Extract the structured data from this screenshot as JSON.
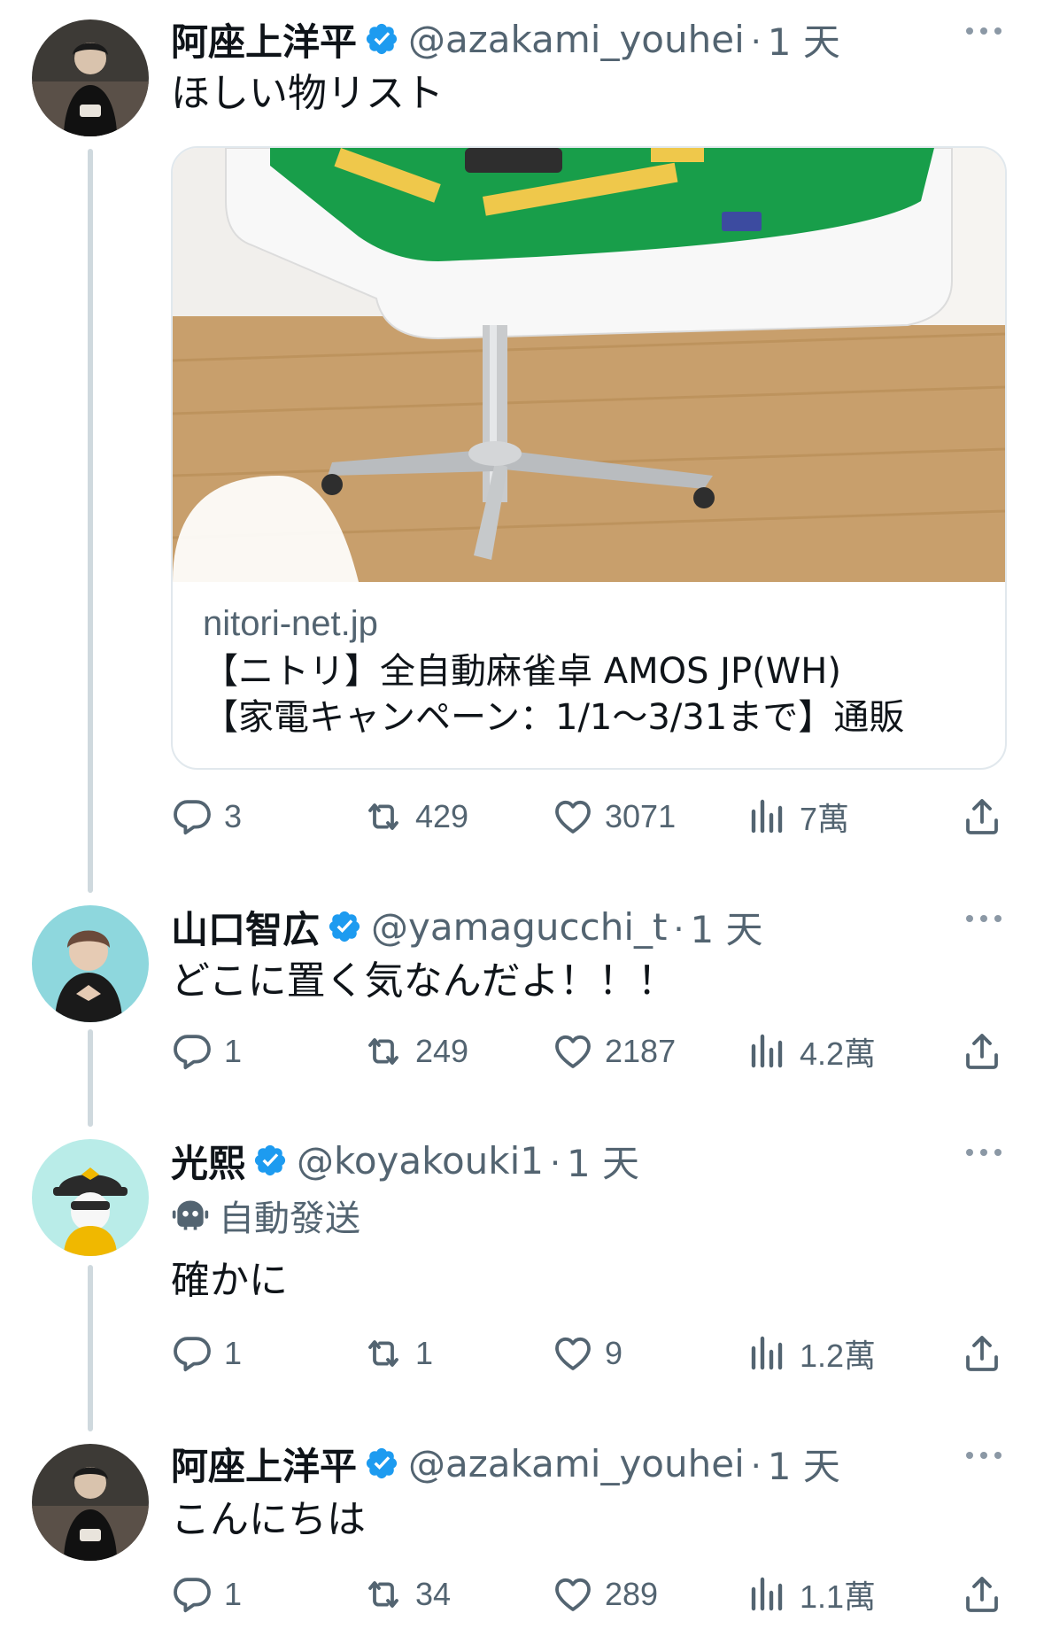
{
  "tweets": [
    {
      "name": "阿座上洋平",
      "handle": "@azakami_youhei",
      "time": "1 天",
      "text": "ほしい物リスト",
      "card": {
        "domain": "nitori-net.jp",
        "title_line1": "【ニトリ】全自動麻雀卓 AMOS JP(WH)",
        "title_line2": "【家電キャンペーン：1/1～3/31まで】通販"
      },
      "stats": {
        "replies": "3",
        "retweets": "429",
        "likes": "3071",
        "views": "7萬"
      }
    },
    {
      "name": "山口智広",
      "handle": "@yamagucchi_t",
      "time": "1 天",
      "text": "どこに置く気なんだよ！！！",
      "stats": {
        "replies": "1",
        "retweets": "249",
        "likes": "2187",
        "views": "4.2萬"
      }
    },
    {
      "name": "光熙",
      "handle": "@koyakouki1",
      "time": "1 天",
      "auto_label": "自動發送",
      "text": "確かに",
      "stats": {
        "replies": "1",
        "retweets": "1",
        "likes": "9",
        "views": "1.2萬"
      }
    },
    {
      "name": "阿座上洋平",
      "handle": "@azakami_youhei",
      "time": "1 天",
      "text": "こんにちは",
      "stats": {
        "replies": "1",
        "retweets": "34",
        "likes": "289",
        "views": "1.1萬"
      }
    }
  ],
  "icons": [
    "verified-badge-icon",
    "more-icon",
    "reply-icon",
    "retweet-icon",
    "like-icon",
    "views-icon",
    "share-icon",
    "bot-icon"
  ],
  "colors": {
    "verified": "#1d9bf0",
    "secondary_text": "#536471",
    "thread_line": "#cfd9de"
  }
}
